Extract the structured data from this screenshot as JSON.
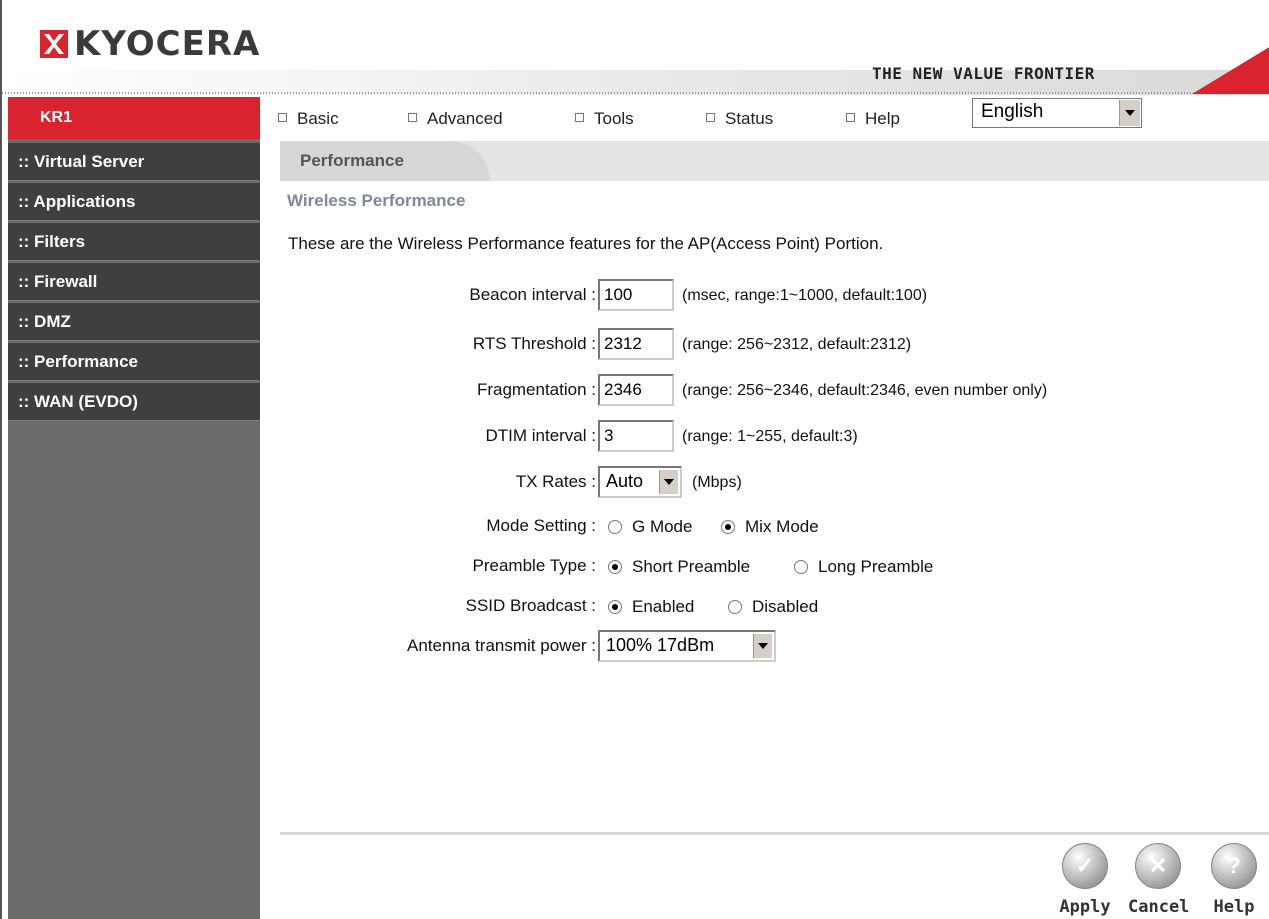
{
  "header": {
    "logo_text": "KYOCERA",
    "tagline": "THE NEW VALUE FRONTIER"
  },
  "sidebar": {
    "model": "KR1",
    "items": [
      {
        "label": ":: Virtual Server"
      },
      {
        "label": ":: Applications"
      },
      {
        "label": ":: Filters"
      },
      {
        "label": ":: Firewall"
      },
      {
        "label": ":: DMZ"
      },
      {
        "label": ":: Performance"
      },
      {
        "label": ":: WAN (EVDO)"
      }
    ]
  },
  "nav": {
    "items": [
      {
        "label": "Basic"
      },
      {
        "label": "Advanced"
      },
      {
        "label": "Tools"
      },
      {
        "label": "Status"
      },
      {
        "label": "Help"
      }
    ],
    "language": "English"
  },
  "page": {
    "tab": "Performance",
    "section_title": "Wireless Performance",
    "intro": "These are the Wireless Performance features for the AP(Access Point) Portion."
  },
  "form": {
    "beacon": {
      "label": "Beacon interval :",
      "value": "100",
      "hint": "(msec, range:1~1000, default:100)"
    },
    "rts": {
      "label": "RTS Threshold :",
      "value": "2312",
      "hint": "(range: 256~2312, default:2312)"
    },
    "frag": {
      "label": "Fragmentation :",
      "value": "2346",
      "hint": "(range: 256~2346, default:2346, even number only)"
    },
    "dtim": {
      "label": "DTIM interval :",
      "value": "3",
      "hint": "(range: 1~255, default:3)"
    },
    "tx": {
      "label": "TX Rates :",
      "value": "Auto",
      "unit": "(Mbps)"
    },
    "mode": {
      "label": "Mode Setting :",
      "option1": "G Mode",
      "option2": "Mix Mode",
      "selected": "Mix Mode"
    },
    "preamble": {
      "label": "Preamble Type :",
      "option1": "Short Preamble",
      "option2": "Long Preamble",
      "selected": "Short Preamble"
    },
    "ssid": {
      "label": "SSID Broadcast :",
      "option1": "Enabled",
      "option2": "Disabled",
      "selected": "Enabled"
    },
    "power": {
      "label": "Antenna transmit power :",
      "value": "100% 17dBm"
    }
  },
  "buttons": {
    "apply": "Apply",
    "cancel": "Cancel",
    "help": "Help"
  },
  "colors": {
    "brand_red": "#d9232e",
    "sidebar_dark": "#3f3f3f",
    "sidebar_bg": "#6b6b6b",
    "section_title": "#7a8a9a"
  }
}
